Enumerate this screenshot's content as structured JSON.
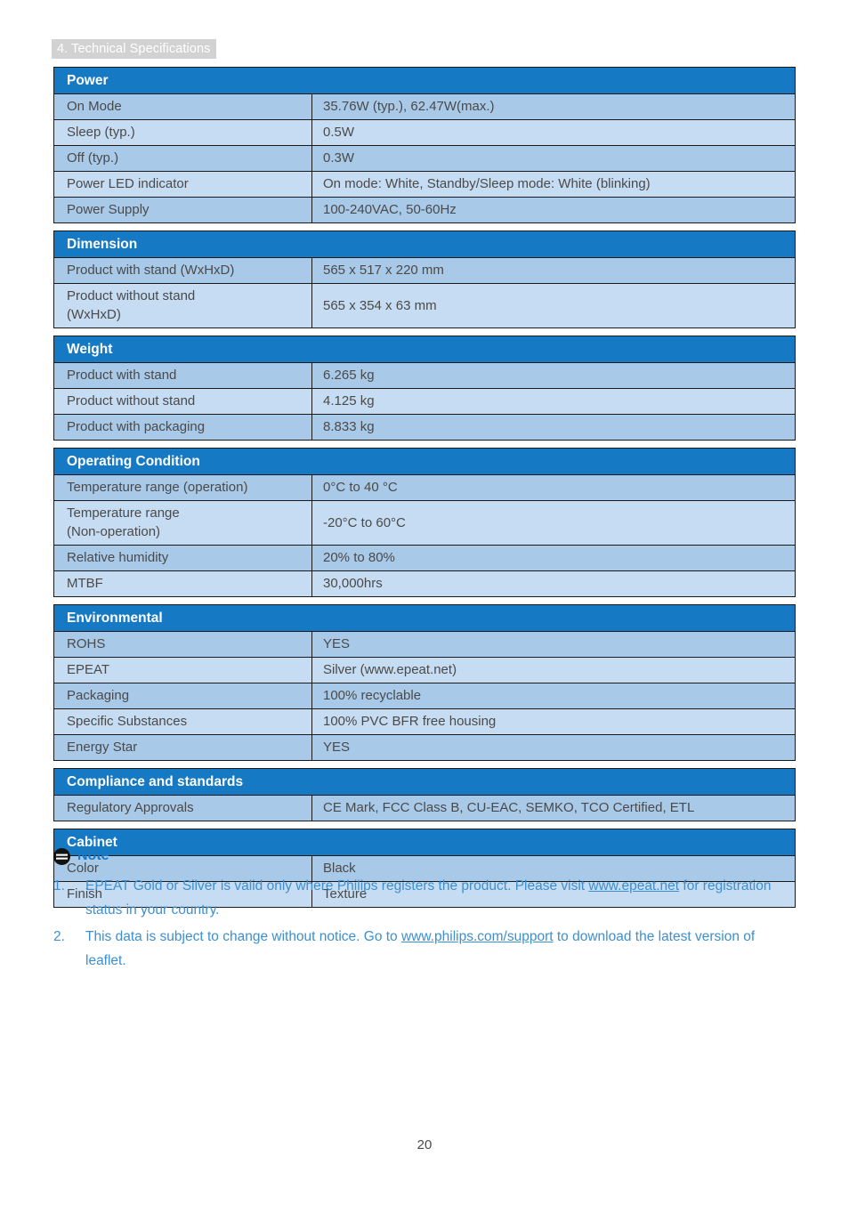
{
  "chapter_tag": "4. Technical Specifications",
  "page_number": "20",
  "colors": {
    "section_header_bg": "#1679c4",
    "row_shade_a": "#a9c9e8",
    "row_shade_b": "#c6dcf2",
    "link": "#3d8fd0",
    "text": "#4a4a4a",
    "chapter_tag_bg": "#d2d2d2"
  },
  "table": {
    "sections": [
      {
        "title": "Power",
        "rows": [
          {
            "label": "On Mode",
            "value": "35.76W (typ.), 62.47W(max.)"
          },
          {
            "label": "Sleep (typ.)",
            "value": "0.5W"
          },
          {
            "label": "Off (typ.)",
            "value": "0.3W"
          },
          {
            "label": "Power LED indicator",
            "value": "On mode: White, Standby/Sleep mode: White (blinking)"
          },
          {
            "label": "Power Supply",
            "value": "100-240VAC, 50-60Hz"
          }
        ]
      },
      {
        "title": "Dimension",
        "rows": [
          {
            "label": "Product with stand (WxHxD)",
            "value": "565 x 517 x 220 mm"
          },
          {
            "label": "Product without stand",
            "label2": "(WxHxD)",
            "value": "565 x 354 x 63 mm"
          }
        ]
      },
      {
        "title": "Weight",
        "rows": [
          {
            "label": "Product with stand",
            "value": "6.265 kg"
          },
          {
            "label": "Product without stand",
            "value": "4.125 kg"
          },
          {
            "label": "Product with packaging",
            "value": "8.833 kg"
          }
        ]
      },
      {
        "title": "Operating Condition",
        "rows": [
          {
            "label": "Temperature range (operation)",
            "value": "0°C to 40 °C"
          },
          {
            "label": "Temperature range",
            "label2": "(Non-operation)",
            "value": "-20°C to 60°C"
          },
          {
            "label": "Relative humidity",
            "value": "20% to 80%"
          },
          {
            "label": "MTBF",
            "value": "30,000hrs"
          }
        ]
      },
      {
        "title": "Environmental",
        "rows": [
          {
            "label": "ROHS",
            "value": "YES"
          },
          {
            "label": "EPEAT",
            "value": "Silver (www.epeat.net)"
          },
          {
            "label": "Packaging",
            "value": "100% recyclable"
          },
          {
            "label": "Specific Substances",
            "value": "100% PVC BFR free housing"
          },
          {
            "label": "Energy Star",
            "value": "YES"
          }
        ]
      },
      {
        "title": "Compliance and standards",
        "rows": [
          {
            "label": "Regulatory Approvals",
            "value": "CE Mark, FCC Class B, CU-EAC, SEMKO, TCO Certified, ETL"
          }
        ]
      },
      {
        "title": "Cabinet",
        "rows": [
          {
            "label": "Color",
            "value": "Black"
          },
          {
            "label": "Finish",
            "value": "Texture"
          }
        ]
      }
    ]
  },
  "note": {
    "icon": "note-icon",
    "title": "Note",
    "items": [
      {
        "number": "1.",
        "text_before": "EPEAT Gold or Silver is valid only where Philips registers the product. Please visit ",
        "link": "www.epeat.net",
        "text_after": " for registration status in your country."
      },
      {
        "number": "2.",
        "text_before": "This data is subject to change without notice. Go to ",
        "link": "www.philips.com/support",
        "text_after": " to download the latest version of leaflet."
      }
    ]
  }
}
